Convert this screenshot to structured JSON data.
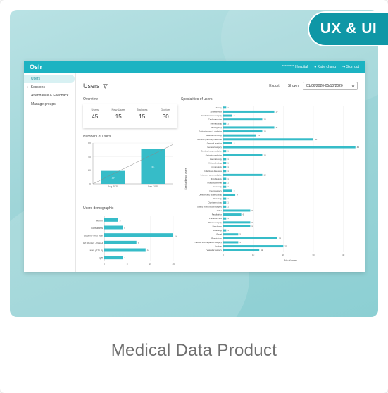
{
  "badge": "UX & UI",
  "caption": "Medical Data Product",
  "app": {
    "logo": "Oslr",
    "hospital": "********* Hospital",
    "user": "Katie chang",
    "signout": "Sign out"
  },
  "sidebar": {
    "items": [
      {
        "label": "Users",
        "active": true
      },
      {
        "label": "Sessions",
        "prefix": "‹"
      },
      {
        "label": "Attendance & Feedback"
      },
      {
        "label": "Manage groups"
      }
    ]
  },
  "header": {
    "title": "Users",
    "export": "Export",
    "shown": "Shown",
    "daterange": "01/06/2020-05/10/2020"
  },
  "overview": {
    "title": "Overview",
    "stats": [
      {
        "label": "Users",
        "value": "45"
      },
      {
        "label": "New Users",
        "value": "15"
      },
      {
        "label": "Trainees",
        "value": "15"
      },
      {
        "label": "Doctors",
        "value": "30"
      }
    ]
  },
  "number_of_users": {
    "title": "Numbers of users"
  },
  "users_demographic": {
    "title": "Users demographic"
  },
  "specialities": {
    "title": "Specialities of users"
  },
  "chart_data": [
    {
      "type": "bar",
      "title": "Numbers of users",
      "categories": [
        "Aug 2020",
        "Sep 2020"
      ],
      "values": [
        19,
        51
      ],
      "ylim": [
        0,
        60
      ],
      "yticks": [
        0,
        20,
        40,
        60
      ],
      "trend_line": true
    },
    {
      "type": "bar",
      "orientation": "horizontal",
      "title": "Users demographic",
      "categories": [
        "Admin",
        "Consultants",
        "Med Student - First Year",
        "Med Student - Year 4",
        "NHS (ST1-2)",
        "SpR"
      ],
      "values": [
        3,
        4,
        15,
        7,
        9,
        4
      ],
      "xlim": [
        0,
        15
      ],
      "xticks": [
        0,
        5,
        10,
        15
      ]
    },
    {
      "type": "bar",
      "orientation": "horizontal",
      "title": "Specialities of users",
      "ylabel": "Specialities of users",
      "xlabel": "No of users",
      "categories": [
        "Airway",
        "Anaesthetics",
        "Cardiothoracic surgery",
        "Cardiovascular",
        "Dermatology",
        "Emergency",
        "Endocrinology & diabetes",
        "Gastroenterology",
        "General (internal) medicine",
        "General practice",
        "General surgery",
        "Genitourinary medicine",
        "Geriatric medicine",
        "Haematology",
        "Histopathology",
        "Immunology",
        "Infectious diseases",
        "Intensive care medicine",
        "Microbiology",
        "Musculoskeletal",
        "Neurology",
        "Neurosurgery",
        "Obstetrics & gynaecology",
        "Oncology",
        "Ophthalmology",
        "Oral & maxillofacial surgery",
        "Other",
        "Paediatrics",
        "Palliative care",
        "Plastic surgery",
        "Psychiatry",
        "Radiology",
        "Renal",
        "Respiratory",
        "Trauma & orthopaedic surgery",
        "Urology",
        "Vascular surgery"
      ],
      "values": [
        1,
        17,
        3,
        13,
        1,
        17,
        13,
        11,
        30,
        3,
        44,
        1,
        13,
        1,
        1,
        1,
        1,
        13,
        1,
        1,
        1,
        3,
        4,
        1,
        1,
        1,
        9,
        6,
        1,
        9,
        9,
        1,
        5,
        18,
        5,
        20,
        12
      ],
      "xlim": [
        0,
        45
      ],
      "xticks": [
        0,
        10,
        20,
        30,
        40
      ]
    }
  ],
  "colors": {
    "accent": "#1cb3c2",
    "bar": "#36bcc8",
    "badge": "#0f97a6"
  }
}
